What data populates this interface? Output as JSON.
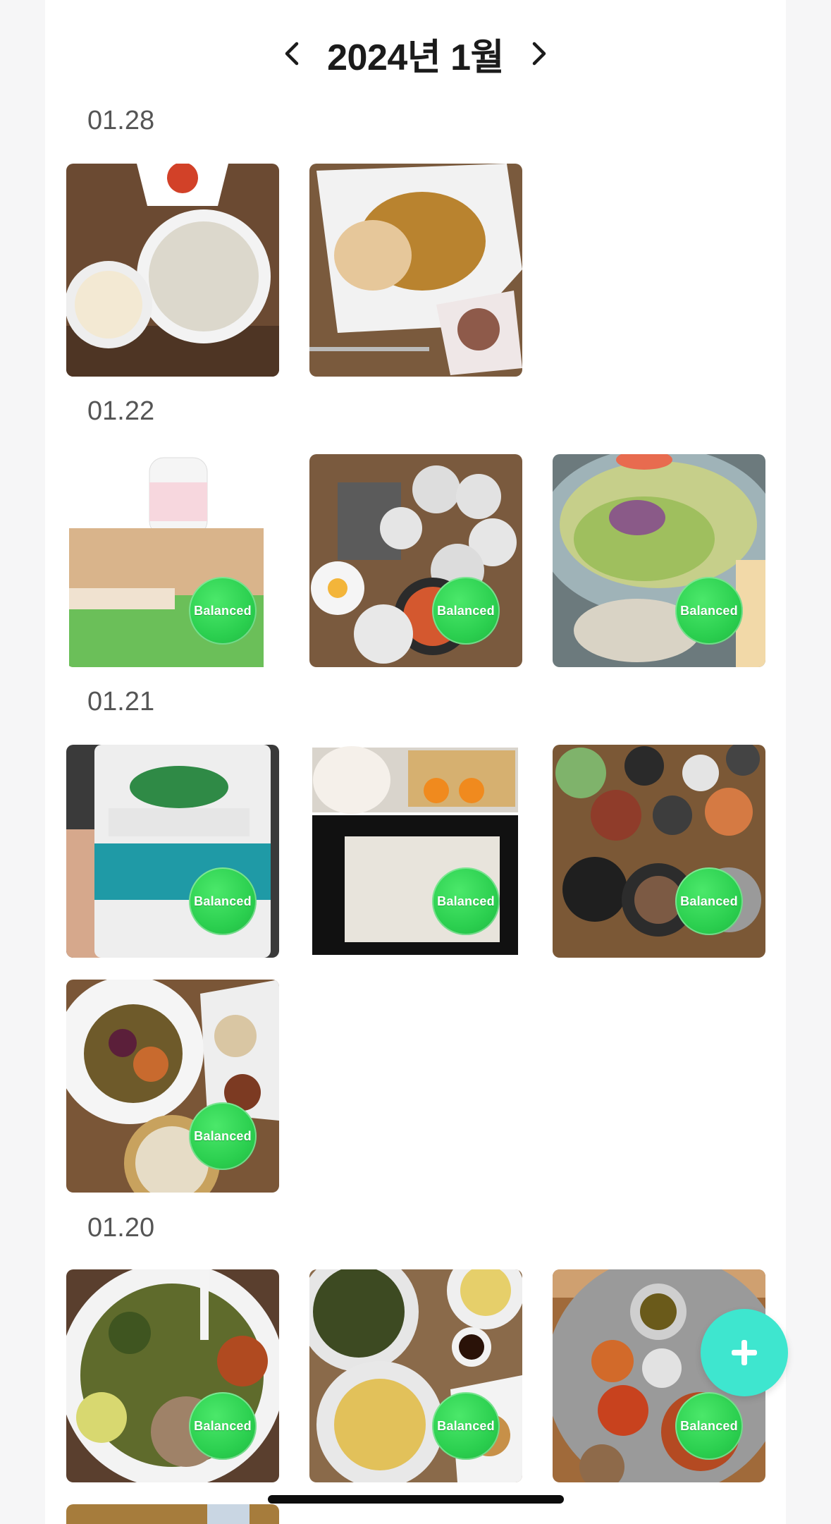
{
  "header": {
    "title": "2024년 1월"
  },
  "sections": [
    {
      "date": "01.28",
      "items": [
        {
          "label": "",
          "theme": "soup"
        },
        {
          "label": "",
          "theme": "curry"
        }
      ]
    },
    {
      "date": "01.22",
      "items": [
        {
          "label": "Balanced",
          "theme": "sandwich"
        },
        {
          "label": "Balanced",
          "theme": "stew"
        },
        {
          "label": "Balanced",
          "theme": "salad"
        }
      ]
    },
    {
      "date": "01.21",
      "items": [
        {
          "label": "Balanced",
          "theme": "protein"
        },
        {
          "label": "Balanced",
          "theme": "egg-cookie"
        },
        {
          "label": "Balanced",
          "theme": "banchan"
        },
        {
          "label": "Balanced",
          "theme": "stirfry"
        }
      ]
    },
    {
      "date": "01.20",
      "items": [
        {
          "label": "Balanced",
          "theme": "plate"
        },
        {
          "label": "Balanced",
          "theme": "seaweed"
        },
        {
          "label": "Balanced",
          "theme": "kimchi"
        }
      ]
    }
  ],
  "fab": {
    "icon": "plus-icon"
  },
  "colors": {
    "badge": "#2bcf4f",
    "fab": "#3ee6cf"
  }
}
